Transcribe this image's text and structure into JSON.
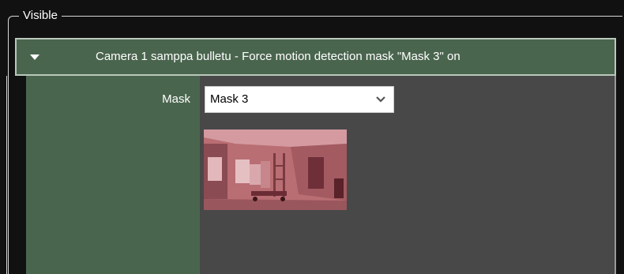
{
  "group": {
    "legend": "Visible"
  },
  "rule": {
    "title": "Camera 1 samppa bulletu - Force motion detection mask \"Mask 3\" on",
    "expanded_icon": "chevron-down-icon"
  },
  "mask": {
    "label": "Mask",
    "selected": "Mask 3",
    "dropdown_icon": "chevron-down-icon"
  },
  "preview": {
    "description_icon": "camera-preview-thumbnail",
    "tint_color": "#c05f68"
  },
  "colors": {
    "background": "#111111",
    "header_green": "#4a654e",
    "content_gray": "#484848",
    "text": "#ffffff"
  }
}
